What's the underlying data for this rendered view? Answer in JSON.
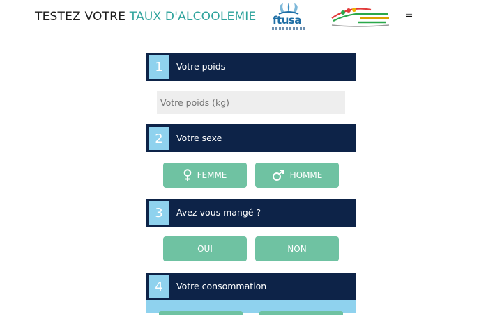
{
  "header": {
    "title_prefix": "TESTEZ VOTRE ",
    "title_accent": "TAUX D'ALCOOLEMIE",
    "logo_ftusa_text": "ftusa"
  },
  "sections": [
    {
      "number": "1",
      "label": "Votre poids"
    },
    {
      "number": "2",
      "label": "Votre sexe"
    },
    {
      "number": "3",
      "label": "Avez-vous mangé ?"
    },
    {
      "number": "4",
      "label": "Votre consommation"
    }
  ],
  "weight": {
    "placeholder": "Votre poids (kg)",
    "value": ""
  },
  "sex": {
    "female_label": "FEMME",
    "male_label": "HOMME"
  },
  "ate": {
    "yes_label": "OUI",
    "no_label": "NON"
  },
  "colors": {
    "navy": "#0d2348",
    "number_box": "#8fd2ee",
    "button": "#6fc2a2",
    "accent_text": "#2fa39c"
  },
  "icons": [
    "female-icon",
    "male-icon",
    "menu-icon"
  ]
}
